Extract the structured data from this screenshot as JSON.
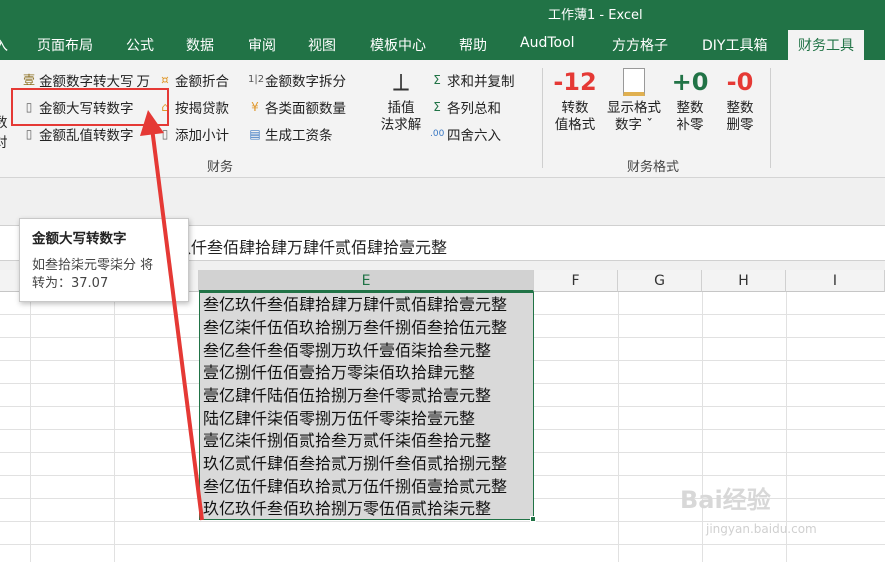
{
  "window": {
    "title": "工作薄1 - Excel"
  },
  "tabs": [
    {
      "label": "入"
    },
    {
      "label": "页面布局"
    },
    {
      "label": "公式"
    },
    {
      "label": "数据"
    },
    {
      "label": "审阅"
    },
    {
      "label": "视图"
    },
    {
      "label": "模板中心"
    },
    {
      "label": "帮助"
    },
    {
      "label": "AudTool"
    },
    {
      "label": "方方格子"
    },
    {
      "label": "DIY工具箱"
    },
    {
      "label": "财务工具"
    }
  ],
  "ribbon": {
    "left_cut": [
      "数",
      "对"
    ],
    "g1": {
      "r1a": "金额数字转大写",
      "r1b": "万",
      "r2": "金额大写转数字",
      "r3": "金额乱值转数字"
    },
    "g2": {
      "r1": "金额折合",
      "r2": "按揭贷款",
      "r3": "添加小计"
    },
    "g3": {
      "r1": "金额数字拆分",
      "r2": "各类面额数量",
      "r3": "生成工资条"
    },
    "g4": {
      "big_l1": "插值",
      "big_l2": "法求解",
      "r1": "求和并复制",
      "r2": "各列总和",
      "r3": "四舍六入"
    },
    "group1_label": "财务",
    "g5": {
      "b1_icon": "-12",
      "b1_l1": "转数",
      "b1_l2": "值格式",
      "b2_l1": "显示格式",
      "b2_l2": "数字 ˇ",
      "b3_icon": "+0",
      "b3_l1": "整数",
      "b3_l2": "补零",
      "b4_icon": "-0",
      "b4_l1": "整数",
      "b4_l2": "删零"
    },
    "group2_label": "财务格式"
  },
  "formula_bar": {
    "text": "玖仟叁佰肆拾肆万肆仟贰佰肆拾壹元整"
  },
  "columns": [
    "E",
    "F",
    "G",
    "H",
    "I"
  ],
  "cells": [
    "叁亿玖仟叁佰肆拾肆万肆仟贰佰肆拾壹元整",
    "叁亿柒仟伍佰玖拾捌万叁仟捌佰叁拾伍元整",
    "叁亿叁仟叁佰零捌万玖仟壹佰柒拾叁元整",
    "壹亿捌仟伍佰壹拾万零柒佰玖拾肆元整",
    "壹亿肆仟陆佰伍拾捌万叁仟零贰拾壹元整",
    "陆亿肆仟柒佰零捌万伍仟零柒拾壹元整",
    "壹亿柒仟捌佰贰拾叁万贰仟柒佰叁拾元整",
    "玖亿贰仟肆佰叁拾贰万捌仟叁佰贰拾捌元整",
    "叁亿伍仟肆佰玖拾贰万伍仟捌佰壹拾贰元整",
    "玖亿玖仟叁佰玖拾捌万零伍佰贰拾柒元整"
  ],
  "tooltip": {
    "title": "金额大写转数字",
    "line1": "如叁拾柒元零柒分 将",
    "line2": "转为：37.07"
  },
  "watermark": {
    "brand": "Bai经验",
    "url": "jingyan.baidu.com"
  },
  "colors": {
    "excel_green": "#217346",
    "highlight_red": "#e53935"
  }
}
